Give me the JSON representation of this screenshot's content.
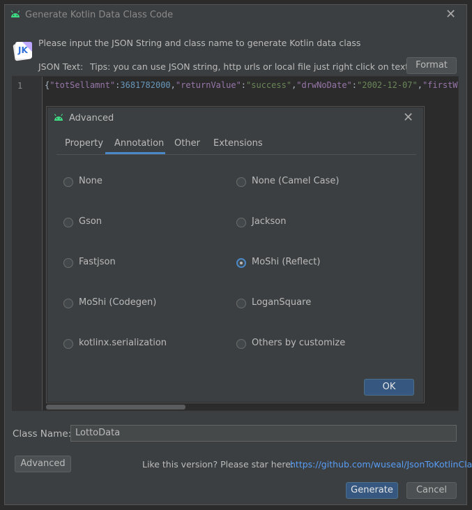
{
  "window": {
    "title": "Generate Kotlin Data Class Code",
    "instruction": "Please input the JSON String and class name to generate Kotlin data class",
    "logo_text": "JK"
  },
  "json_section": {
    "label": "JSON Text:",
    "tip": "Tips: you can use JSON string, http urls or local file just right click on text area",
    "format_button": "Format"
  },
  "editor": {
    "line_number": "1",
    "tokens": {
      "brace": "{",
      "k1": "\"totSellamnt\"",
      "c1": ":",
      "v1": "3681782000",
      "s1": ",",
      "k2": "\"returnValue\"",
      "c2": ":",
      "v2": "\"success\"",
      "s2": ",",
      "k3": "\"drwNoDate\"",
      "c3": ":",
      "v3": "\"2002-12-07\"",
      "s3": ",",
      "k4": "\"firstWina"
    }
  },
  "class_name": {
    "label": "Class Name:",
    "value": "LottoData"
  },
  "footer": {
    "advanced_button": "Advanced",
    "star_text": "Like this version? Please star here:",
    "star_link": "https://github.com/wuseal/JsonToKotlinClass",
    "generate_button": "Generate",
    "cancel_button": "Cancel"
  },
  "advanced_dialog": {
    "title": "Advanced",
    "tabs": [
      "Property",
      "Annotation",
      "Other",
      "Extensions"
    ],
    "selected_tab": "Annotation",
    "options": [
      {
        "label": "None",
        "checked": false
      },
      {
        "label": "None (Camel Case)",
        "checked": false
      },
      {
        "label": "Gson",
        "checked": false
      },
      {
        "label": "Jackson",
        "checked": false
      },
      {
        "label": "Fastjson",
        "checked": false
      },
      {
        "label": "MoShi (Reflect)",
        "checked": true
      },
      {
        "label": "MoShi (Codegen)",
        "checked": false
      },
      {
        "label": "LoganSquare",
        "checked": false
      },
      {
        "label": "kotlinx.serialization",
        "checked": false
      },
      {
        "label": "Others by customize",
        "checked": false
      }
    ],
    "ok_button": "OK"
  },
  "colors": {
    "accent": "#4a88c7",
    "android_green": "#3ddc84",
    "link": "#589df6"
  },
  "icons": {
    "app": "android-icon",
    "close": "close-icon",
    "logo": "json-to-kotlin-logo"
  }
}
